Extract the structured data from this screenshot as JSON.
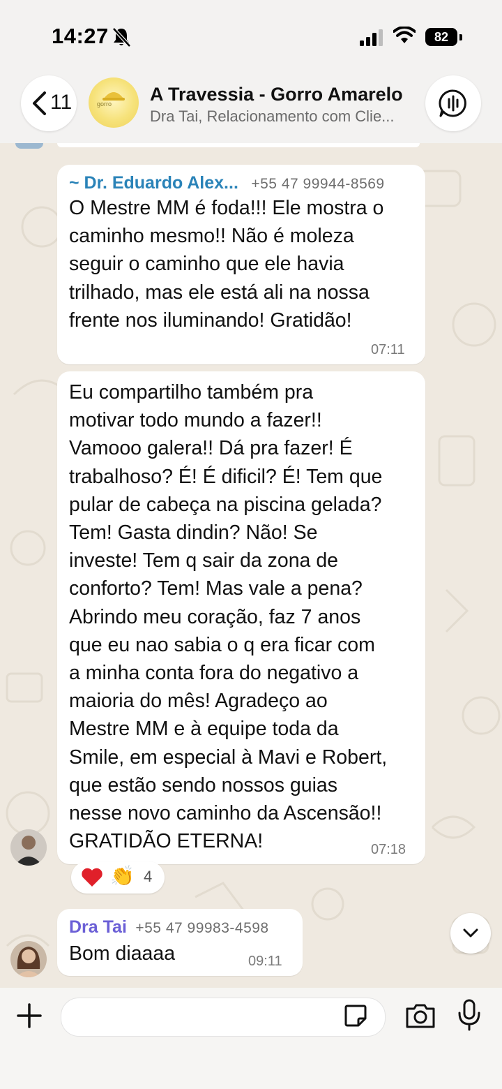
{
  "status_bar": {
    "time": "14:27",
    "battery": "82"
  },
  "header": {
    "back_count": "11",
    "title": "A Travessia - Gorro Amarelo",
    "subtitle": "Dra Tai, Relacionamento com Clie...",
    "avatar_text": "gorro"
  },
  "messages": [
    {
      "sender": "~ Dr. Eduardo Alex...",
      "phone": "+55 47 99944-8569",
      "sender_color": "#2a83b8",
      "lines": [
        "O Mestre MM é foda!!! Ele mostra o",
        "caminho mesmo!! Não é moleza",
        "seguir o caminho que ele havia",
        "trilhado, mas ele está ali na nossa",
        "frente nos iluminando! Gratidão!"
      ],
      "time": "07:11"
    },
    {
      "lines": [
        "Eu compartilho também pra",
        "motivar todo mundo a fazer!!",
        "Vamooo galera!! Dá pra fazer! É",
        "trabalhoso? É! É dificil? É! Tem que",
        "pular de cabeça na piscina gelada?",
        "Tem! Gasta dindin? Não! Se",
        "investe! Tem q sair da zona de",
        "conforto? Tem! Mas vale a pena?",
        "Abrindo meu coração, faz 7 anos",
        "que eu nao sabia o q era ficar com",
        "a minha conta fora do negativo a",
        "maioria do mês! Agradeço ao",
        "Mestre MM e à equipe toda da",
        "Smile, em especial à Mavi e Robert,",
        "que estão sendo nossos guias",
        "nesse novo caminho da Ascensão!!",
        "GRATIDÃO ETERNA!"
      ],
      "time": "07:18",
      "reactions": {
        "emojis": [
          "❤️",
          "👏"
        ],
        "count": "4"
      }
    },
    {
      "sender": "Dra Tai",
      "phone": "+55 47 99983-4598",
      "sender_color": "#6b5fd6",
      "lines": [
        "Bom diaaaa"
      ],
      "time": "09:11"
    }
  ],
  "input": {
    "placeholder": ""
  },
  "icons": {
    "back": "chevron-left-icon",
    "call": "voice-chat-icon",
    "scroll": "chevron-down-icon",
    "plus": "plus-icon",
    "sticker": "sticker-icon",
    "camera": "camera-icon",
    "mic": "microphone-icon",
    "mute": "bell-slash-icon"
  }
}
